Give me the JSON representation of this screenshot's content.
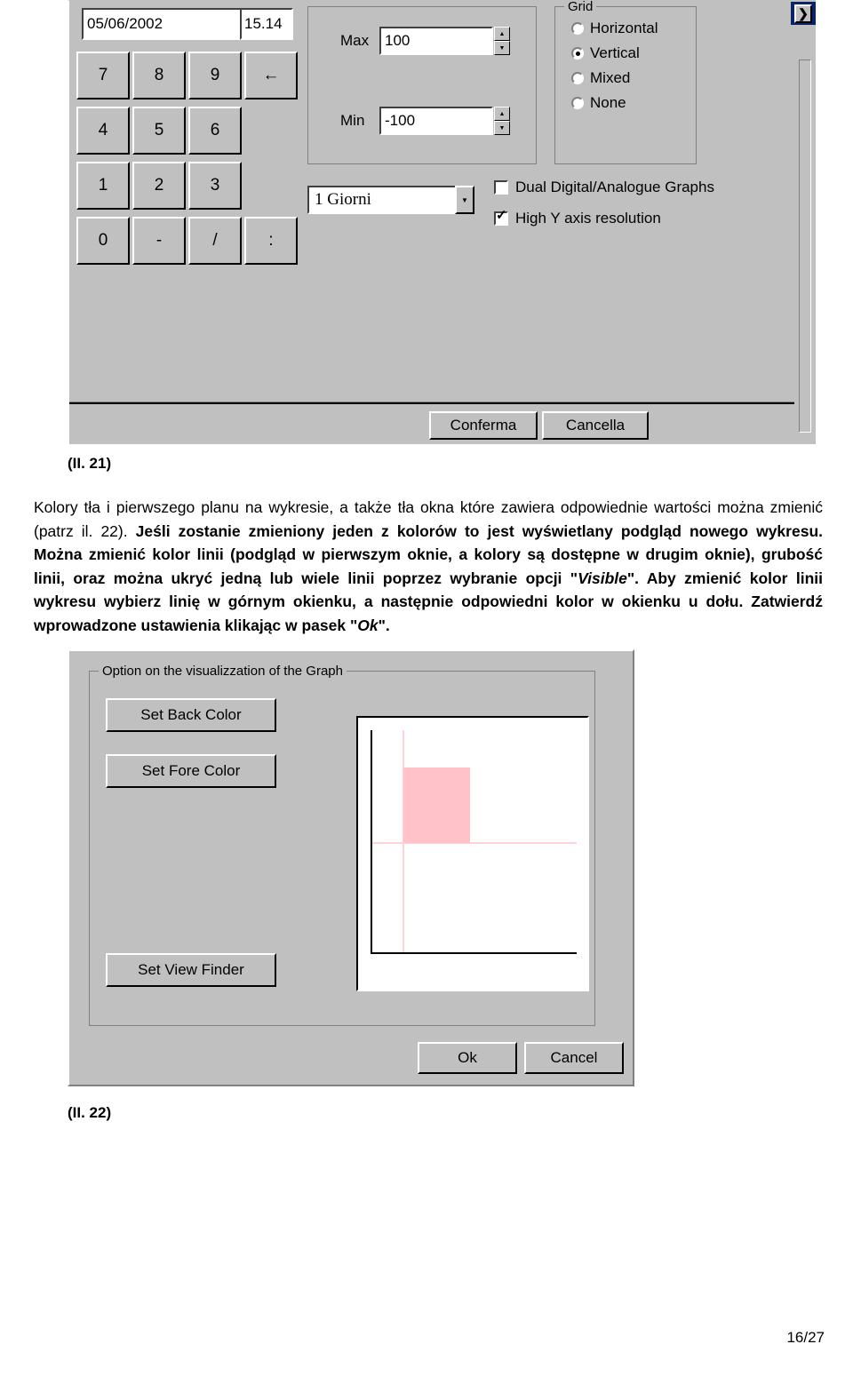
{
  "figure1": {
    "caption": "(II. 21)",
    "date_field": {
      "value": "05/06/2002"
    },
    "time_field": {
      "value": "15.14"
    },
    "keypad": [
      {
        "label": "7",
        "name": "key-7"
      },
      {
        "label": "8",
        "name": "key-8"
      },
      {
        "label": "9",
        "name": "key-9"
      },
      {
        "label": "←",
        "name": "key-backspace"
      },
      {
        "label": "4",
        "name": "key-4"
      },
      {
        "label": "5",
        "name": "key-5"
      },
      {
        "label": "6",
        "name": "key-6"
      },
      {
        "label": "1",
        "name": "key-1"
      },
      {
        "label": "2",
        "name": "key-2"
      },
      {
        "label": "3",
        "name": "key-3"
      },
      {
        "label": "0",
        "name": "key-0"
      },
      {
        "label": "-",
        "name": "key-dash"
      },
      {
        "label": "/",
        "name": "key-slash"
      },
      {
        "label": ":",
        "name": "key-colon"
      }
    ],
    "range": {
      "max_label": "Max",
      "max_value": "100",
      "min_label": "Min",
      "min_value": "-100",
      "spin_up": "▲",
      "spin_down": "▼"
    },
    "grid_group": {
      "title": "Grid",
      "options": [
        {
          "label": "Horizontal",
          "selected": false
        },
        {
          "label": "Vertical",
          "selected": true
        },
        {
          "label": "Mixed",
          "selected": false
        },
        {
          "label": "None",
          "selected": false
        }
      ]
    },
    "period_combo": {
      "value": "1  Giorni",
      "arrow": "▼"
    },
    "checkboxes": [
      {
        "label": "Dual Digital/Analogue Graphs",
        "checked": false
      },
      {
        "label": "High Y axis resolution",
        "checked": true
      }
    ],
    "buttons": {
      "confirm": "Conferma",
      "cancel": "Cancella"
    },
    "titlebar": {
      "close_glyph": "❯"
    }
  },
  "body_text": {
    "line1_a": "Kolory tła i pierwszego planu na wykresie, a także tła okna które zawiera odpowiednie wartości można zmienić (patrz il. 22). ",
    "line1_b": "Jeśli zostanie zmieniony jeden z kolorów to jest wyświetlany podgląd nowego wykresu.",
    "line1_c": " Można zmienić kolor linii (podgląd w pierwszym oknie, a kolory są dostępne w drugim oknie), grubość linii, oraz można ukryć jedną lub wiele linii poprzez wybranie opcji \"",
    "visible_italic": "Visible",
    "line1_d": "\". Aby zmienić kolor linii wykresu wybierz linię w górnym okienku, a następnie odpowiedni kolor w okienku u dołu. Zatwierdź wprowadzone ustawienia klikając w pasek \"",
    "ok_italic": "Ok",
    "line1_e": "\"."
  },
  "figure2": {
    "caption": "(II. 22)",
    "group_title": "Option on the visualizzation of the Graph",
    "buttons": {
      "set_back_color": "Set Back Color",
      "set_fore_color": "Set Fore Color",
      "set_view_finder": "Set View Finder",
      "ok": "Ok",
      "cancel": "Cancel"
    },
    "preview": {
      "back_color": "#ffffff",
      "fore_color": "#ffc2c8",
      "grid_color": "#ffd3d6",
      "axis_color": "#000000"
    }
  },
  "page_number": "16/27"
}
